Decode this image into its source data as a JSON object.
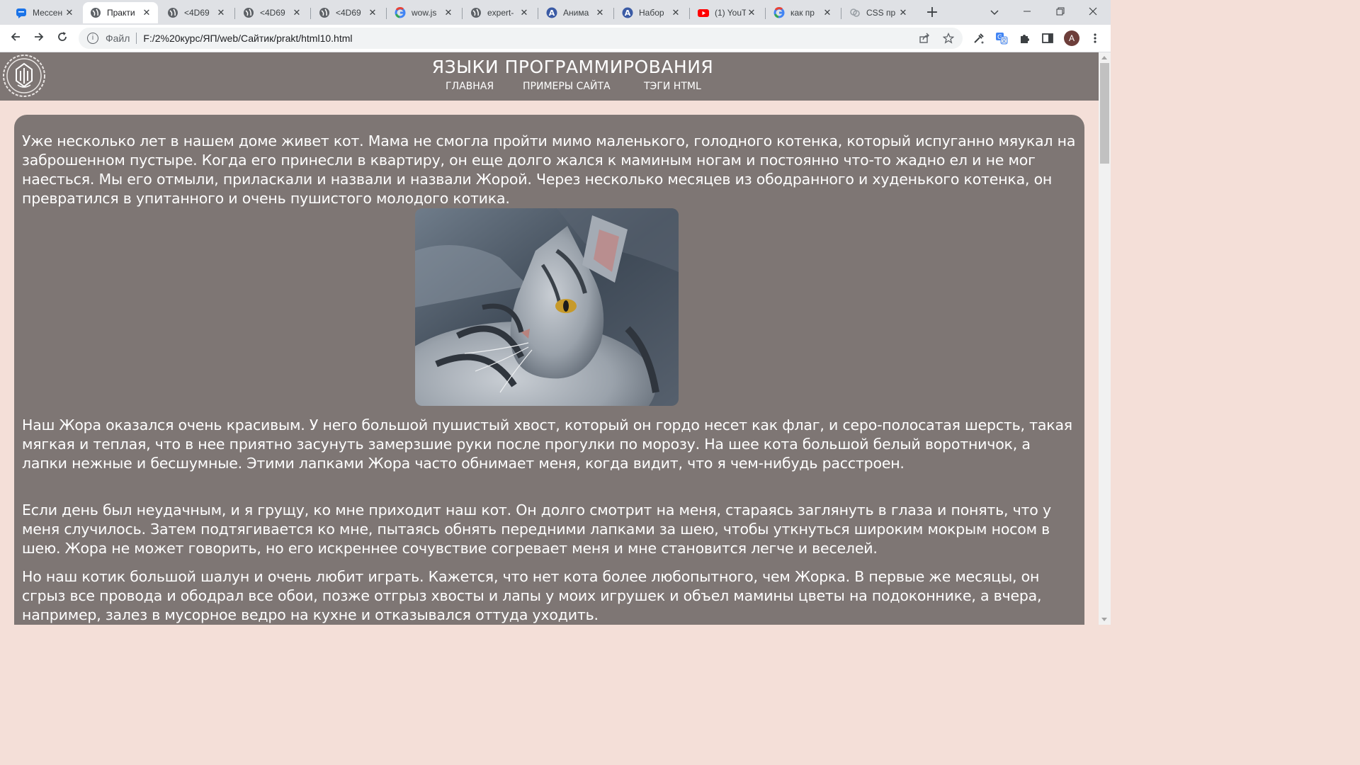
{
  "browser": {
    "tabs": [
      {
        "title": "Мессен",
        "icon": "messenger-icon"
      },
      {
        "title": "Практи",
        "icon": "globe-icon",
        "active": true
      },
      {
        "title": "<4D69",
        "icon": "globe-icon"
      },
      {
        "title": "<4D69",
        "icon": "globe-icon"
      },
      {
        "title": "<4D69",
        "icon": "globe-icon"
      },
      {
        "title": "wow.js",
        "icon": "google-icon"
      },
      {
        "title": "expert-",
        "icon": "globe-icon"
      },
      {
        "title": "Анима",
        "icon": "a-icon"
      },
      {
        "title": "Набор",
        "icon": "a-icon"
      },
      {
        "title": "(1) YouT",
        "icon": "youtube-icon"
      },
      {
        "title": "как пр",
        "icon": "google-icon"
      },
      {
        "title": "CSS пр",
        "icon": "css-icon"
      }
    ],
    "address": {
      "scheme_label": "Файл",
      "url": "F:/2%20курс/ЯП/web/Сайтик/prakt/html10.html"
    },
    "profile_initial": "A"
  },
  "site": {
    "title": "ЯЗЫКИ ПРОГРАММИРОВАНИЯ",
    "nav": [
      "ГЛАВНАЯ",
      "ПРИМЕРЫ САЙТА",
      "ТЭГИ HTML"
    ]
  },
  "article": {
    "paragraphs": [
      "Уже несколько лет в нашем доме живет кот. Мама не смогла пройти мимо маленького, голодного котенка, который испуганно мяукал на заброшенном пустыре. Когда его принесли в квартиру, он еще долго жался к маминым ногам и постоянно что-то жадно ел и не мог наесться. Мы его отмыли, приласкали и назвали и назвали Жорой. Через несколько месяцев из ободранного и худенького котенка, он превратился в упитанного и очень пушистого молодого котика.",
      "Наш Жора оказался очень красивым. У него большой пушистый хвост, который он гордо несет как флаг, и серо-полосатая шерсть, такая мягкая и теплая, что в нее приятно засунуть замерзшие руки после прогулки по морозу. На шее кота большой белый воротничок, а лапки нежные и бесшумные. Этими лапками Жора часто обнимает меня, когда видит, что я чем-нибудь расстроен.",
      "Если день был неудачным, и я грущу, ко мне приходит наш кот. Он долго смотрит на меня, стараясь заглянуть в глаза и понять, что у меня случилось. Затем подтягивается ко мне, пытаясь обнять передними лапками за шею, чтобы уткнуться широким мокрым носом в шею. Жора не может говорить, но его искреннее сочувствие согревает меня и мне становится легче и веселей.",
      "Но наш котик большой шалун и очень любит играть. Кажется, что нет кота более любопытного, чем Жорка. В первые же месяцы, он сгрыз все провода и ободрал все обои, позже отгрыз хвосты и лапы у моих игрушек и объел мамины цветы на подоконнике, а вчера, например, залез в мусорное ведро на кухне и отказывался оттуда уходить."
    ]
  }
}
